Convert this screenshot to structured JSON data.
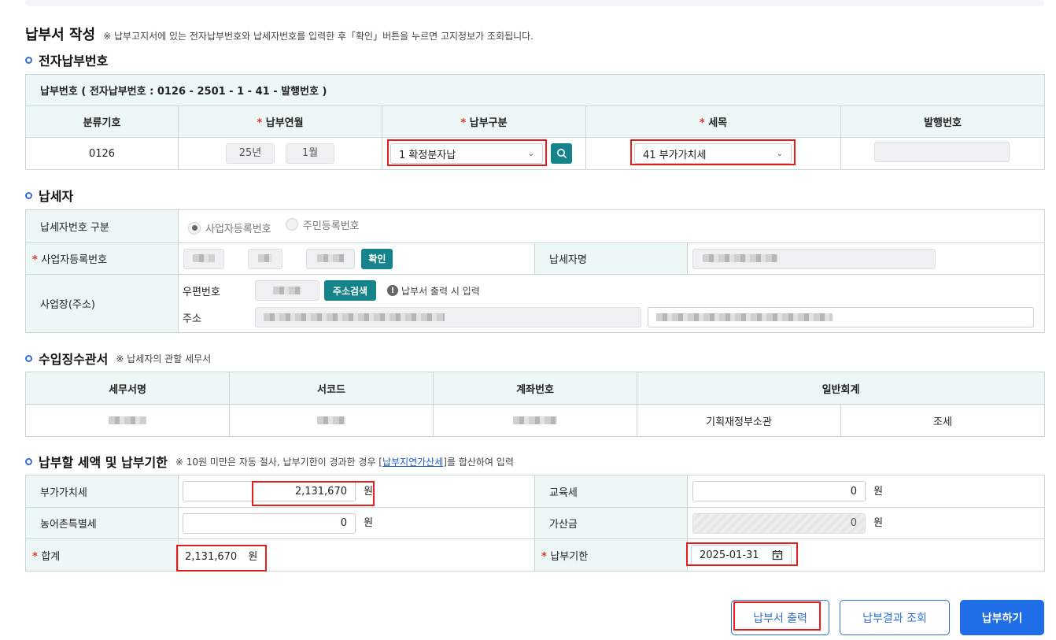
{
  "header": {
    "title": "납부서 작성",
    "note": "※ 납부고지서에 있는 전자납부번호와 납세자번호를 입력한 후「확인」버튼을 누르면 고지정보가 조회됩니다."
  },
  "section_epay": {
    "title": "전자납부번호",
    "caption": "납부번호 ( 전자납부번호 : 0126 - 2501 - 1 - 41 - 발행번호 )",
    "col_class": "분류기호",
    "col_ym": "납부연월",
    "col_type": "납부구분",
    "col_item": "세목",
    "col_issue": "발행번호",
    "class_code": "0126",
    "year": "25년",
    "month": "1월",
    "pay_type": "1 확정분자납",
    "tax_item": "41 부가가치세"
  },
  "section_taxpayer": {
    "title": "납세자",
    "id_type_label": "납세자번호 구분",
    "radio_biz": "사업자등록번호",
    "radio_resident": "주민등록번호",
    "biz_no_label": "사업자등록번호",
    "confirm_btn": "확인",
    "name_label": "납세자명",
    "address_label": "사업장(주소)",
    "zip_label": "우편번호",
    "addr_search_btn": "주소검색",
    "addr_hint": "납부서 출력 시 입력",
    "addr_label": "주소"
  },
  "section_office": {
    "title": "수입징수관서",
    "note": "※ 납세자의 관할 세무서",
    "col_office": "세무서명",
    "col_code": "서코드",
    "col_account": "계좌번호",
    "col_general": "일반회계",
    "general_1": "기획재정부소관",
    "general_2": "조세"
  },
  "section_amount": {
    "title": "납부할 세액 및 납부기한",
    "note_before": "※ 10원 미만은 자동 절사, 납부기한이 경과한 경우 [",
    "note_link": "납부지연가산세",
    "note_after": "]를 합산하여 입력",
    "vat_label": "부가가치세",
    "vat_value": "2,131,670",
    "edu_label": "교육세",
    "edu_value": "0",
    "rural_label": "농어촌특별세",
    "rural_value": "0",
    "penalty_label": "가산금",
    "penalty_value": "0",
    "total_label": "합계",
    "total_value": "2,131,670",
    "due_label": "납부기한",
    "due_value": "2025-01-31",
    "unit": "원"
  },
  "buttons": {
    "print": "납부서 출력",
    "result": "납부결과 조회",
    "pay": "납부하기"
  },
  "colors": {
    "accent_blue": "#1f6ee8",
    "teal": "#14838a",
    "highlight_red": "#e51d1d",
    "header_bg": "#edf7f6"
  }
}
